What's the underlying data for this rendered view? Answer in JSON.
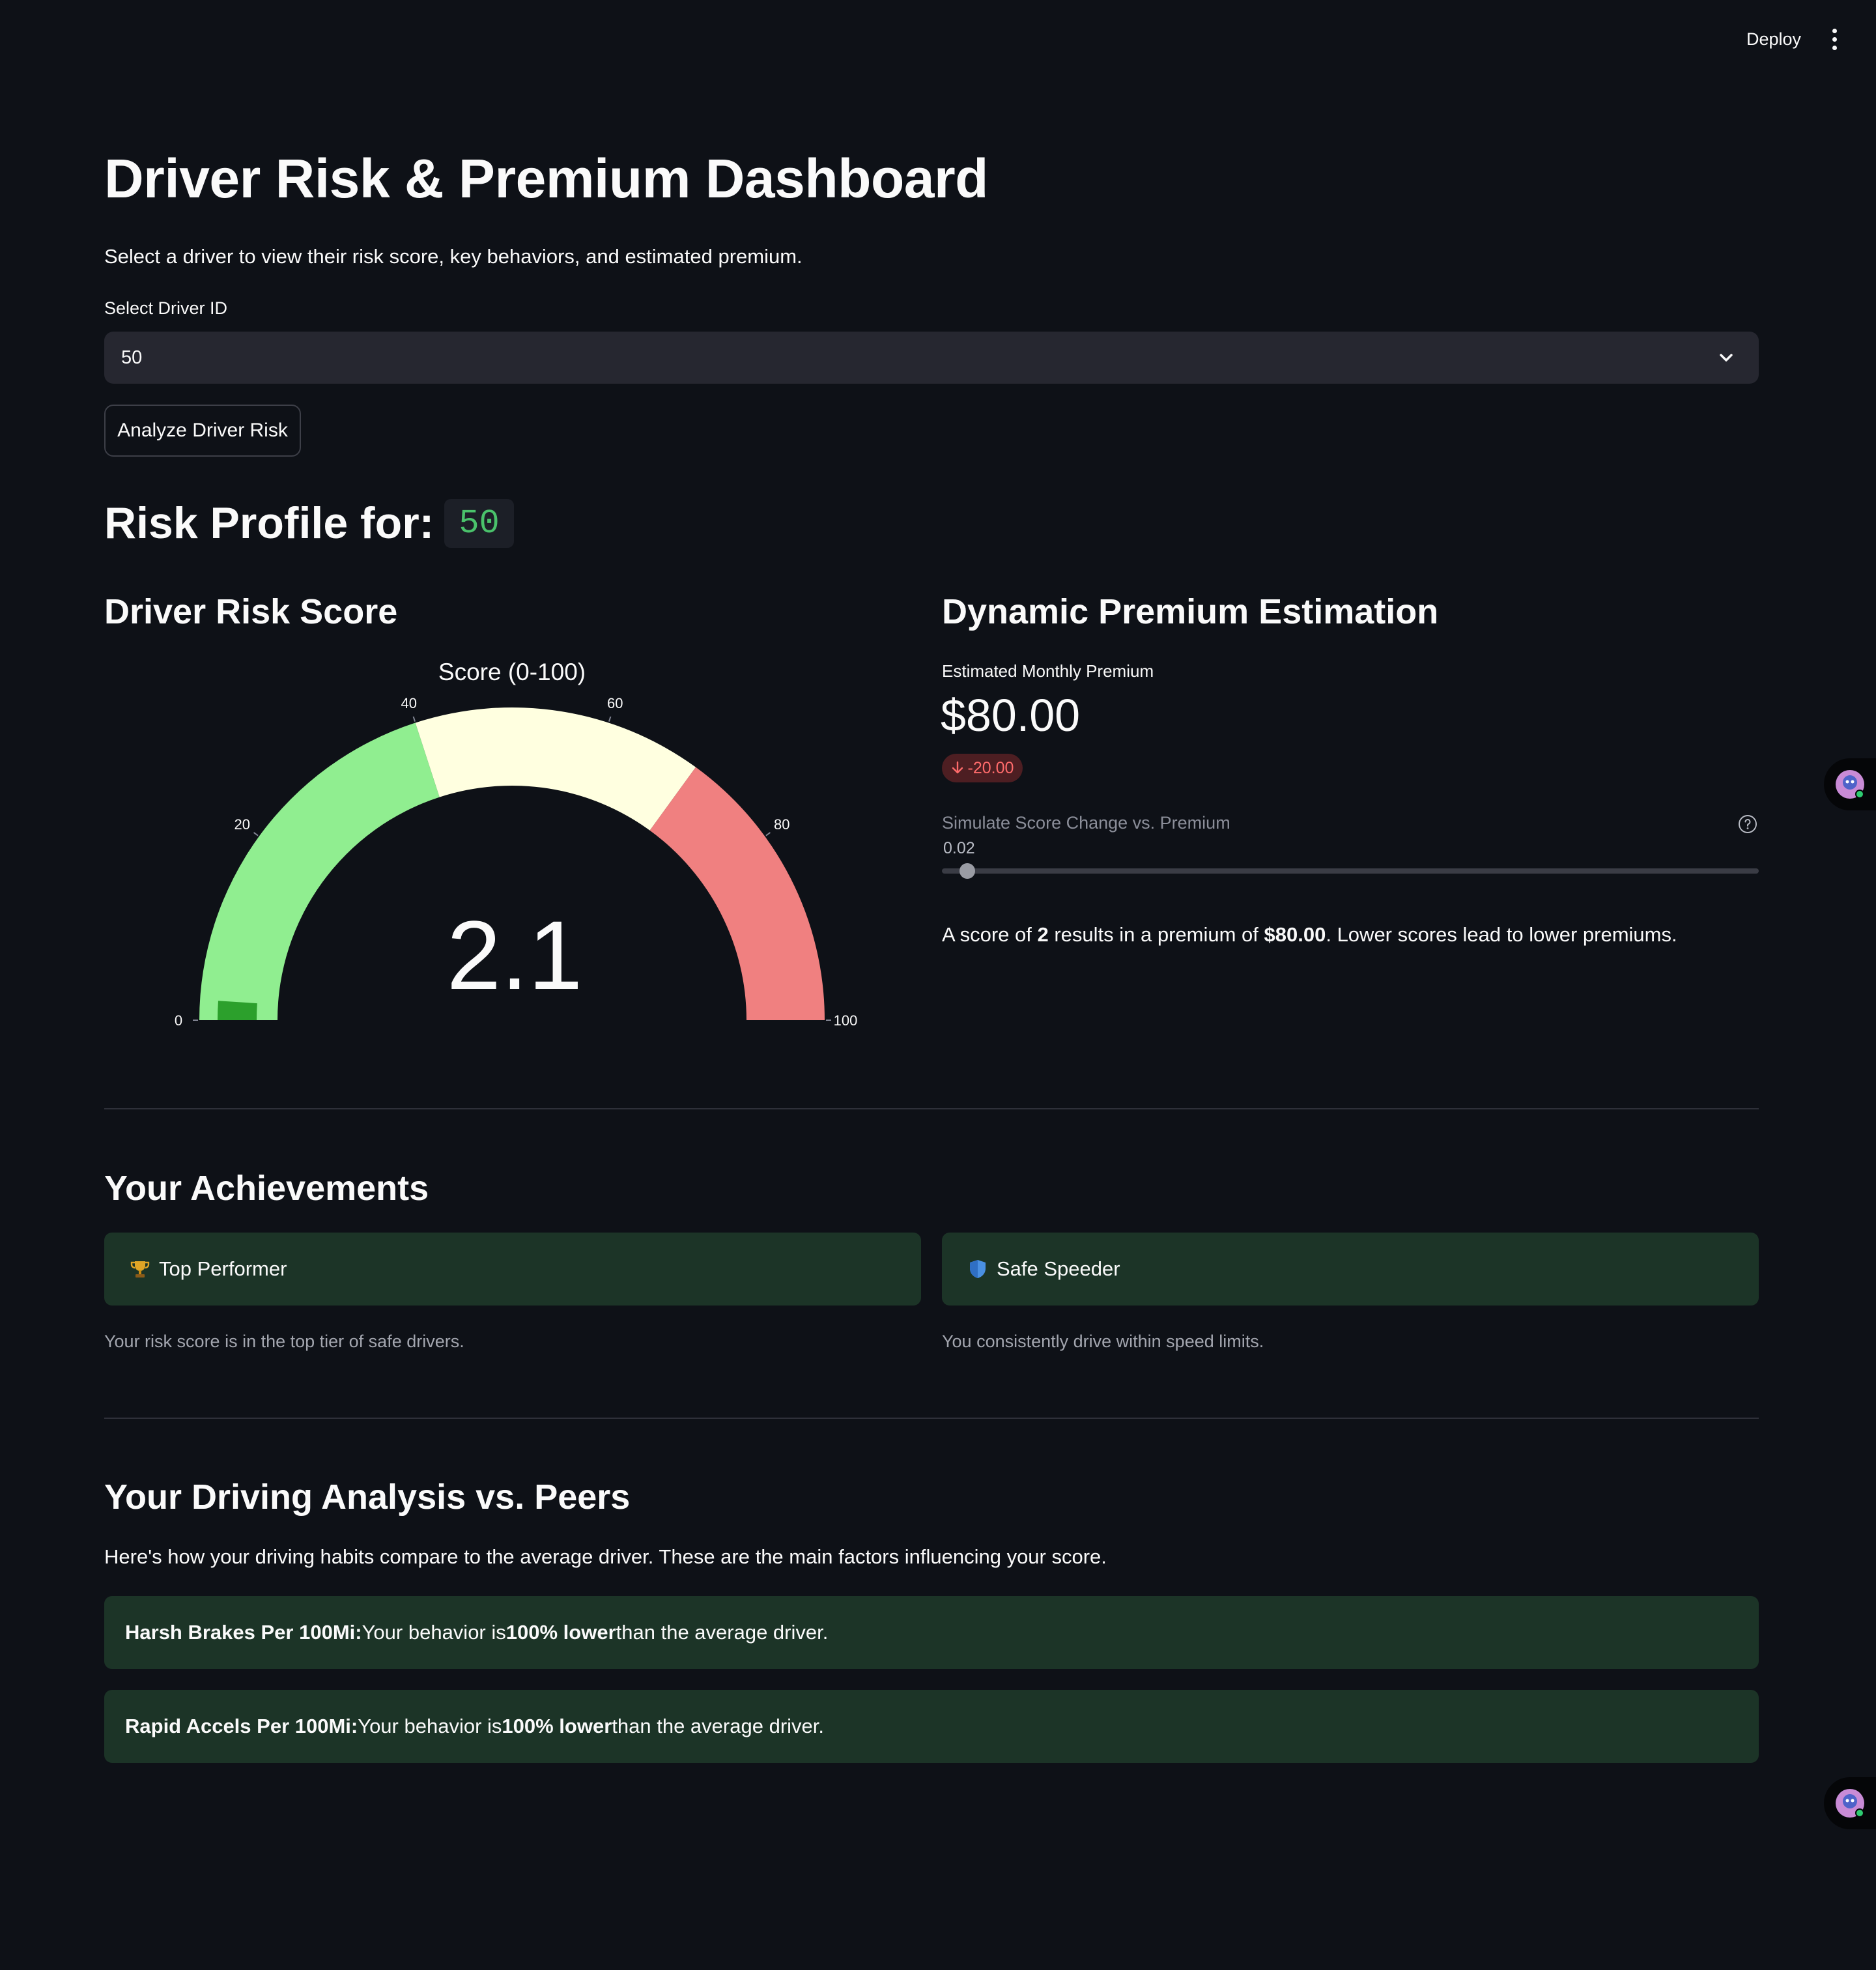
{
  "toolbar": {
    "deploy_label": "Deploy",
    "menu_icon": "kebab-menu-icon"
  },
  "header": {
    "title": "Driver Risk & Premium Dashboard",
    "subtitle": "Select a driver to view their risk score, key behaviors, and estimated premium."
  },
  "driver_select": {
    "label": "Select Driver ID",
    "value": "50",
    "icon": "chevron-down-icon"
  },
  "analyze_button": {
    "label": "Analyze Driver Risk"
  },
  "profile": {
    "heading": "Risk Profile for:",
    "driver_id": "50"
  },
  "risk_score": {
    "heading": "Driver Risk Score",
    "gauge_title": "Score (0-100)",
    "value_text": "2.1",
    "value": 2.1,
    "min": 0,
    "max": 100,
    "ticks": [
      "0",
      "20",
      "40",
      "60",
      "80",
      "100"
    ],
    "bands": [
      {
        "from": 0,
        "to": 40,
        "color": "#90ee90"
      },
      {
        "from": 40,
        "to": 70,
        "color": "#ffffe0"
      },
      {
        "from": 70,
        "to": 100,
        "color": "#f08080"
      }
    ],
    "bar_color": "#2ca02c"
  },
  "premium": {
    "heading": "Dynamic Premium Estimation",
    "metric_label": "Estimated Monthly Premium",
    "metric_value": "$80.00",
    "delta": "-20.00",
    "delta_color": "#ff6b6b",
    "slider_label": "Simulate Score Change vs. Premium",
    "slider_value": "0.02",
    "slider_fraction": 0.02,
    "summary": {
      "p1": "A score of ",
      "score": "2",
      "p2": " results in a premium of ",
      "premium": "$80.00",
      "p3": ". Lower scores lead to lower premiums."
    }
  },
  "achievements": {
    "heading": "Your Achievements",
    "items": [
      {
        "icon": "trophy-icon",
        "title": "Top Performer",
        "caption": "Your risk score is in the top tier of safe drivers."
      },
      {
        "icon": "shield-icon",
        "title": "Safe Speeder",
        "caption": "You consistently drive within speed limits."
      }
    ]
  },
  "peers": {
    "heading": "Your Driving Analysis vs. Peers",
    "intro": "Here's how your driving habits compare to the average driver. These are the main factors influencing your score.",
    "items": [
      {
        "metric": "Harsh Brakes Per 100Mi:",
        "p1": " Your behavior is ",
        "strong": "100% lower",
        "p2": " than the average driver."
      },
      {
        "metric": "Rapid Accels Per 100Mi:",
        "p1": " Your behavior is ",
        "strong": "100% lower",
        "p2": " than the average driver."
      }
    ]
  }
}
